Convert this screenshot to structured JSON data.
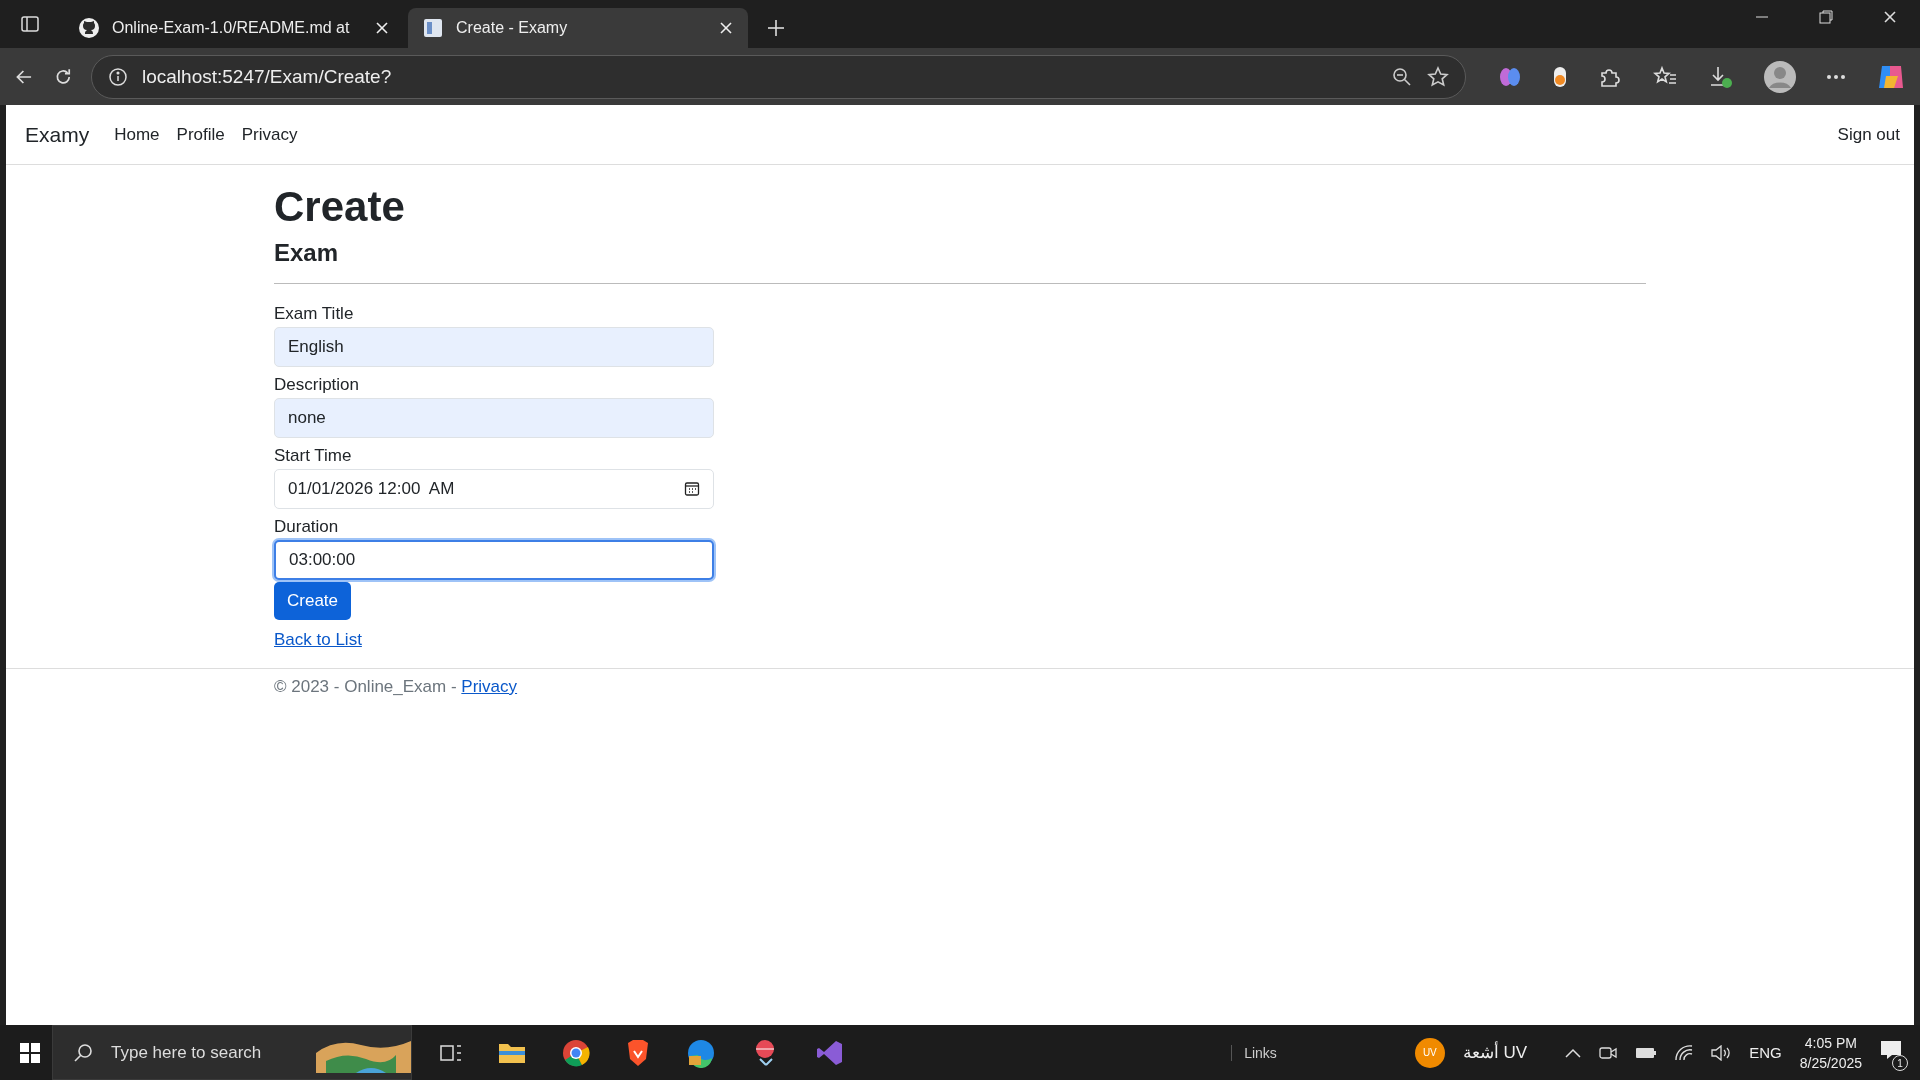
{
  "browser": {
    "tabs": [
      {
        "title": "Online-Exam-1.0/README.md at",
        "selected": false
      },
      {
        "title": "Create - Examy",
        "selected": true
      }
    ],
    "address": "localhost:5247/Exam/Create?"
  },
  "navbar": {
    "brand": "Examy",
    "links": [
      "Home",
      "Profile",
      "Privacy"
    ],
    "sign_out": "Sign out"
  },
  "page": {
    "title": "Create",
    "subtitle": "Exam",
    "fields": [
      {
        "label": "Exam Title",
        "value": "English",
        "kind": "text",
        "autofilled": true,
        "focused": false
      },
      {
        "label": "Description",
        "value": "none",
        "kind": "text",
        "autofilled": true,
        "focused": false
      },
      {
        "label": "Start Time",
        "value": "01/01/2026 12:00  AM",
        "kind": "datetime",
        "autofilled": false,
        "focused": false
      },
      {
        "label": "Duration",
        "value": "03:00:00",
        "kind": "text",
        "autofilled": false,
        "focused": true
      }
    ],
    "submit": "Create",
    "back_link": "Back to List"
  },
  "footer": {
    "text": "© 2023 - Online_Exam - ",
    "link": "Privacy"
  },
  "taskbar": {
    "search_placeholder": "Type here to search",
    "links": "Links",
    "weather_badge": "UV",
    "weather_text": "أشعة UV",
    "language": "ENG",
    "time": "4:05 PM",
    "date": "8/25/2025",
    "notifications": "1"
  }
}
